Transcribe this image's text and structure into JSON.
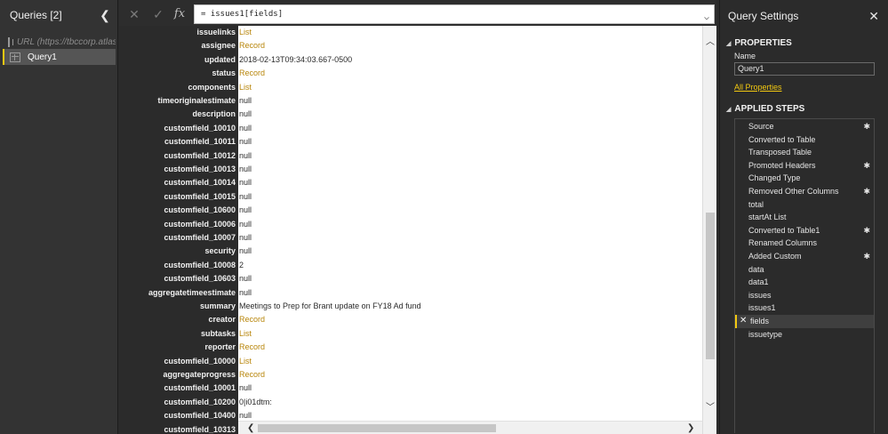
{
  "queries_pane": {
    "title": "Queries [2]",
    "collapse_glyph": "❮",
    "items": [
      {
        "label": "URL (https://tbccorp.atlas...",
        "icon": "table-icon"
      },
      {
        "label": "Query1",
        "icon": "table-icon",
        "selected": true
      }
    ]
  },
  "formula_bar": {
    "cancel_glyph": "✕",
    "commit_glyph": "✓",
    "fx_label": "fx",
    "formula": "= issues1[fields]",
    "expand_glyph": "⌵"
  },
  "grid": {
    "rows": [
      {
        "key": "issuelinks",
        "value": "List",
        "link": true
      },
      {
        "key": "assignee",
        "value": "Record",
        "link": true
      },
      {
        "key": "updated",
        "value": "2018-02-13T09:34:03.667-0500",
        "link": false
      },
      {
        "key": "status",
        "value": "Record",
        "link": true
      },
      {
        "key": "components",
        "value": "List",
        "link": true
      },
      {
        "key": "timeoriginalestimate",
        "value": "null",
        "link": false
      },
      {
        "key": "description",
        "value": "null",
        "link": false
      },
      {
        "key": "customfield_10010",
        "value": "null",
        "link": false
      },
      {
        "key": "customfield_10011",
        "value": "null",
        "link": false
      },
      {
        "key": "customfield_10012",
        "value": "null",
        "link": false
      },
      {
        "key": "customfield_10013",
        "value": "null",
        "link": false
      },
      {
        "key": "customfield_10014",
        "value": "null",
        "link": false
      },
      {
        "key": "customfield_10015",
        "value": "null",
        "link": false
      },
      {
        "key": "customfield_10600",
        "value": "null",
        "link": false
      },
      {
        "key": "customfield_10006",
        "value": "null",
        "link": false
      },
      {
        "key": "customfield_10007",
        "value": "null",
        "link": false
      },
      {
        "key": "security",
        "value": "null",
        "link": false
      },
      {
        "key": "customfield_10008",
        "value": "2",
        "link": false
      },
      {
        "key": "customfield_10603",
        "value": "null",
        "link": false
      },
      {
        "key": "aggregatetimeestimate",
        "value": "null",
        "link": false
      },
      {
        "key": "summary",
        "value": "Meetings to Prep for Brant update on FY18 Ad fund",
        "link": false
      },
      {
        "key": "creator",
        "value": "Record",
        "link": true
      },
      {
        "key": "subtasks",
        "value": "List",
        "link": true
      },
      {
        "key": "reporter",
        "value": "Record",
        "link": true
      },
      {
        "key": "customfield_10000",
        "value": "List",
        "link": true
      },
      {
        "key": "aggregateprogress",
        "value": "Record",
        "link": true
      },
      {
        "key": "customfield_10001",
        "value": "null",
        "link": false
      },
      {
        "key": "customfield_10200",
        "value": "0|i01dtm:",
        "link": false
      },
      {
        "key": "customfield_10400",
        "value": "null",
        "link": false
      },
      {
        "key": "customfield_10313",
        "value": "",
        "link": false
      }
    ],
    "scroll_up": "︿",
    "scroll_down": "﹀",
    "scroll_left": "❮",
    "scroll_right": "❯"
  },
  "settings": {
    "title": "Query Settings",
    "close_glyph": "✕",
    "properties_heading": "PROPERTIES",
    "name_label": "Name",
    "name_value": "Query1",
    "all_properties_link": "All Properties",
    "steps_heading": "APPLIED STEPS",
    "collapse_glyph": "◢",
    "steps": [
      {
        "label": "Source",
        "gear": true
      },
      {
        "label": "Converted to Table",
        "gear": false
      },
      {
        "label": "Transposed Table",
        "gear": false
      },
      {
        "label": "Promoted Headers",
        "gear": true
      },
      {
        "label": "Changed Type",
        "gear": false
      },
      {
        "label": "Removed Other Columns",
        "gear": true
      },
      {
        "label": "total",
        "gear": false
      },
      {
        "label": "startAt List",
        "gear": false
      },
      {
        "label": "Converted to Table1",
        "gear": true
      },
      {
        "label": "Renamed Columns",
        "gear": false
      },
      {
        "label": "Added Custom",
        "gear": true
      },
      {
        "label": "data",
        "gear": false
      },
      {
        "label": "data1",
        "gear": false
      },
      {
        "label": "issues",
        "gear": false
      },
      {
        "label": "issues1",
        "gear": false
      },
      {
        "label": "fields",
        "gear": false,
        "selected": true
      },
      {
        "label": "issuetype",
        "gear": false
      }
    ],
    "gear_glyph": "✱",
    "delete_glyph": "✕"
  },
  "colors": {
    "accent": "#f2c811",
    "link_value": "#b8860b",
    "pane_bg": "#2b2b2b"
  }
}
